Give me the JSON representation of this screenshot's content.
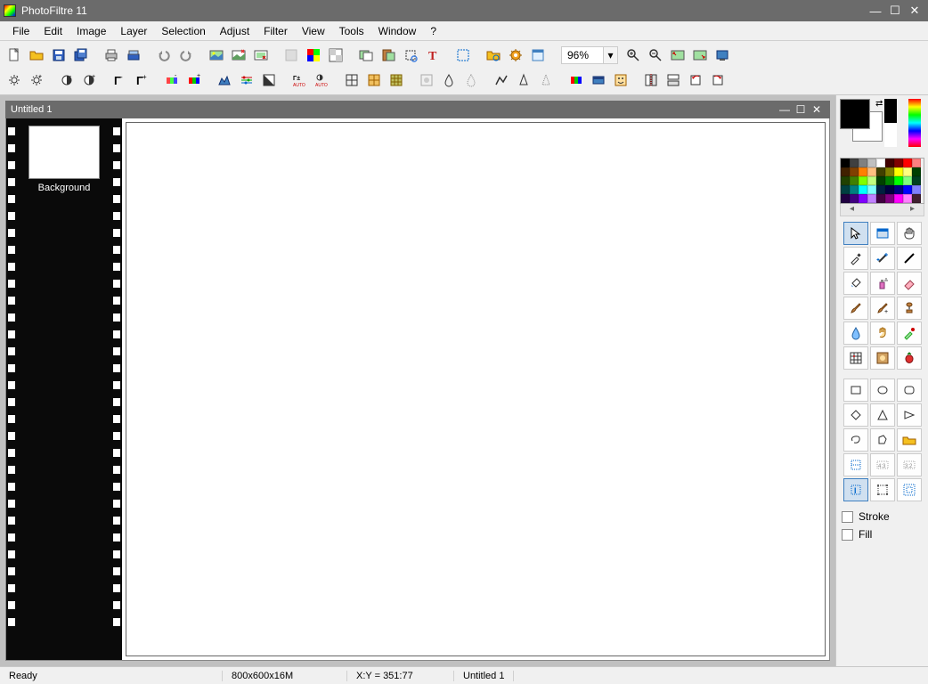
{
  "app": {
    "title": "PhotoFiltre 11"
  },
  "menu": [
    "File",
    "Edit",
    "Image",
    "Layer",
    "Selection",
    "Adjust",
    "Filter",
    "View",
    "Tools",
    "Window",
    "?"
  ],
  "toolbar": {
    "zoom": "96%"
  },
  "doc": {
    "title": "Untitled 1",
    "layer_label": "Background"
  },
  "status": {
    "ready": "Ready",
    "dims": "800x600x16M",
    "pos": "X:Y = 351:77",
    "name": "Untitled 1"
  },
  "options": {
    "stroke": "Stroke",
    "fill": "Fill"
  },
  "palette": [
    "#000000",
    "#404040",
    "#808080",
    "#c0c0c0",
    "#ffffff",
    "#400000",
    "#800000",
    "#ff0000",
    "#ff8080",
    "#402000",
    "#804000",
    "#ff8000",
    "#ffc080",
    "#404000",
    "#808000",
    "#ffff00",
    "#ffff80",
    "#004000",
    "#204000",
    "#408000",
    "#80ff00",
    "#c0ff80",
    "#004000",
    "#008000",
    "#00ff00",
    "#80ff80",
    "#004020",
    "#004040",
    "#008080",
    "#00ffff",
    "#80ffff",
    "#002040",
    "#000040",
    "#000080",
    "#0000ff",
    "#8080ff",
    "#200040",
    "#400080",
    "#8000ff",
    "#c080ff",
    "#400040",
    "#800080",
    "#ff00ff",
    "#ff80ff",
    "#402030"
  ]
}
